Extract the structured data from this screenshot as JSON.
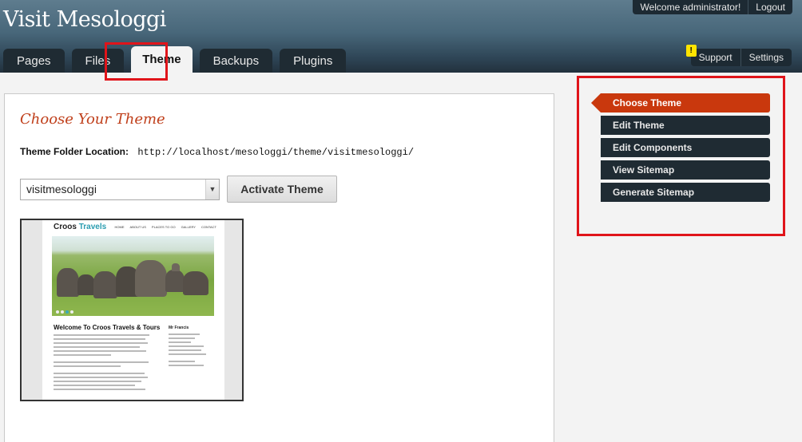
{
  "site": {
    "title": "Visit Mesologgi"
  },
  "userbar": {
    "welcome": "Welcome administrator!",
    "logout": "Logout"
  },
  "tabs": [
    {
      "label": "Pages"
    },
    {
      "label": "Files"
    },
    {
      "label": "Theme",
      "active": true
    },
    {
      "label": "Backups"
    },
    {
      "label": "Plugins"
    }
  ],
  "rightbar": {
    "support": "Support",
    "settings": "Settings",
    "warning_glyph": "!"
  },
  "main": {
    "title": "Choose Your Theme",
    "folder_label": "Theme Folder Location:",
    "folder_path": "http://localhost/mesologgi/theme/visitmesologgi/",
    "theme_select_value": "visitmesologgi",
    "activate_label": "Activate Theme"
  },
  "preview": {
    "logo_main": "Croos",
    "logo_accent": "Travels",
    "nav": [
      "HOME",
      "ABOUT US",
      "PLACES TO GO",
      "GALLERY",
      "CONTACT"
    ],
    "heading": "Welcome To Croos Travels & Tours",
    "side_title": "Mr Francis"
  },
  "sidemenu": {
    "items": [
      {
        "label": "Choose Theme",
        "active": true
      },
      {
        "label": "Edit Theme"
      },
      {
        "label": "Edit Components"
      },
      {
        "label": "View Sitemap"
      },
      {
        "label": "Generate Sitemap"
      }
    ]
  },
  "colors": {
    "accent": "#c9380d",
    "highlight": "#e0141a",
    "dark": "#1f2b33"
  }
}
